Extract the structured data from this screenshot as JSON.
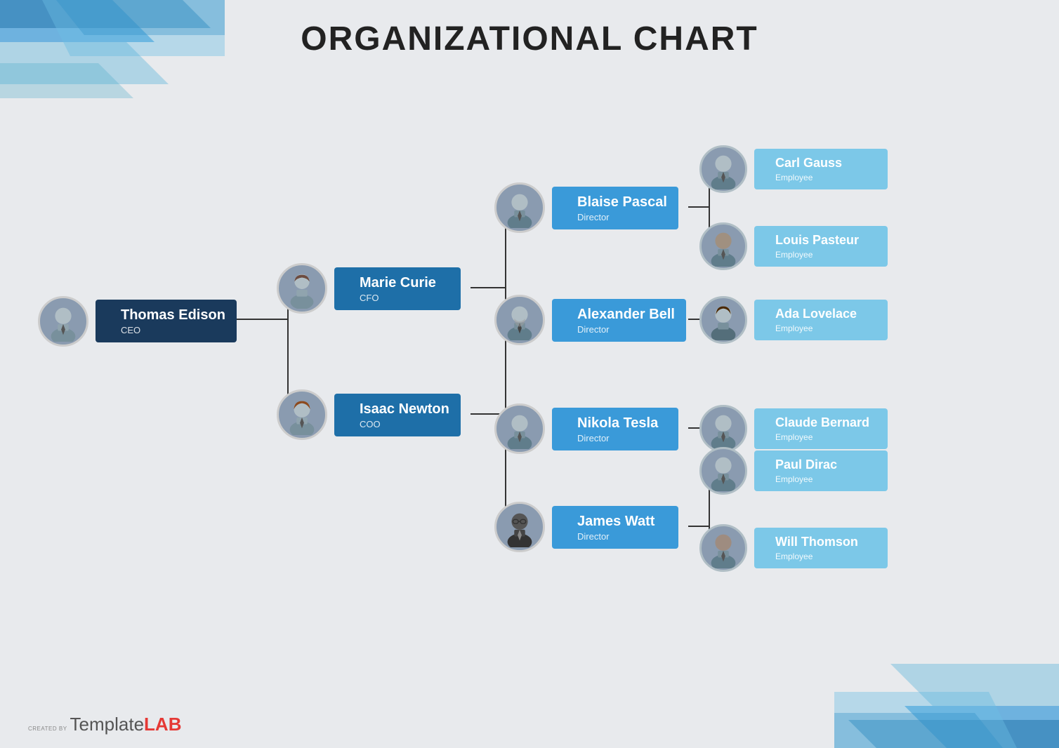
{
  "page": {
    "title": "ORGANIZATIONAL CHART",
    "background_color": "#e8eaed"
  },
  "watermark": {
    "created_by": "CREATED BY",
    "brand1": "Template",
    "brand2": "LAB"
  },
  "nodes": {
    "ceo": {
      "name": "Thomas Edison",
      "role": "CEO"
    },
    "cfo": {
      "name": "Marie Curie",
      "role": "CFO"
    },
    "coo": {
      "name": "Isaac Newton",
      "role": "COO"
    },
    "dir1": {
      "name": "Blaise Pascal",
      "role": "Director"
    },
    "dir2": {
      "name": "Alexander Bell",
      "role": "Director"
    },
    "dir3": {
      "name": "Nikola Tesla",
      "role": "Director"
    },
    "dir4": {
      "name": "James Watt",
      "role": "Director"
    },
    "emp1": {
      "name": "Carl Gauss",
      "role": "Employee"
    },
    "emp2": {
      "name": "Louis Pasteur",
      "role": "Employee"
    },
    "emp3": {
      "name": "Ada Lovelace",
      "role": "Employee"
    },
    "emp4": {
      "name": "Claude Bernard",
      "role": "Employee"
    },
    "emp5": {
      "name": "Paul Dirac",
      "role": "Employee"
    },
    "emp6": {
      "name": "Will Thomson",
      "role": "Employee"
    }
  }
}
